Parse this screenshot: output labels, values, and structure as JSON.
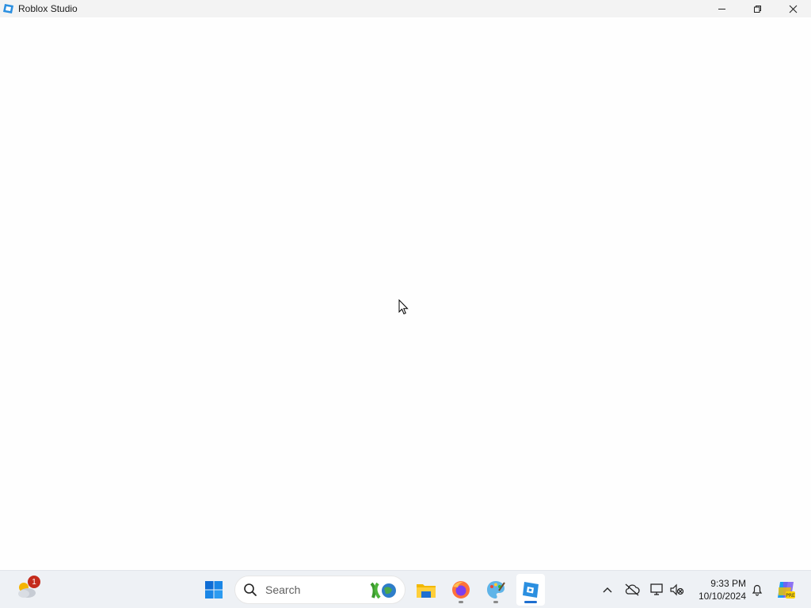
{
  "window": {
    "title": "Roblox Studio",
    "icon": "roblox-studio-icon",
    "controls": [
      "minimize-icon",
      "restore-icon",
      "close-icon"
    ]
  },
  "taskbar": {
    "weather": {
      "icon": "weather-cloud-sun-icon",
      "badge_count": "1"
    },
    "start": {
      "icon": "windows-start-icon"
    },
    "search": {
      "label": "Search",
      "icon": "search-icon"
    },
    "apps": [
      {
        "name": "File Explorer",
        "icon": "folder-icon",
        "running": false
      },
      {
        "name": "Firefox",
        "icon": "firefox-icon",
        "running": true
      },
      {
        "name": "Paint",
        "icon": "paint-palette-icon",
        "running": true
      },
      {
        "name": "Roblox Studio",
        "icon": "roblox-studio-icon",
        "running": true,
        "active": true
      }
    ],
    "tray": {
      "icons": [
        "chevron-up-icon",
        "cloud-offline-icon",
        "network-icon",
        "volume-muted-icon"
      ],
      "time": "9:33 PM",
      "date": "10/10/2024",
      "notification_icon": "bell-icon",
      "copilot_icon": "copilot-icon"
    }
  },
  "colors": {
    "accent": "#1e6fd0",
    "badge": "#c42b1c",
    "taskbar_bg": "#eef1f5",
    "titlebar_bg": "#f3f3f3"
  }
}
